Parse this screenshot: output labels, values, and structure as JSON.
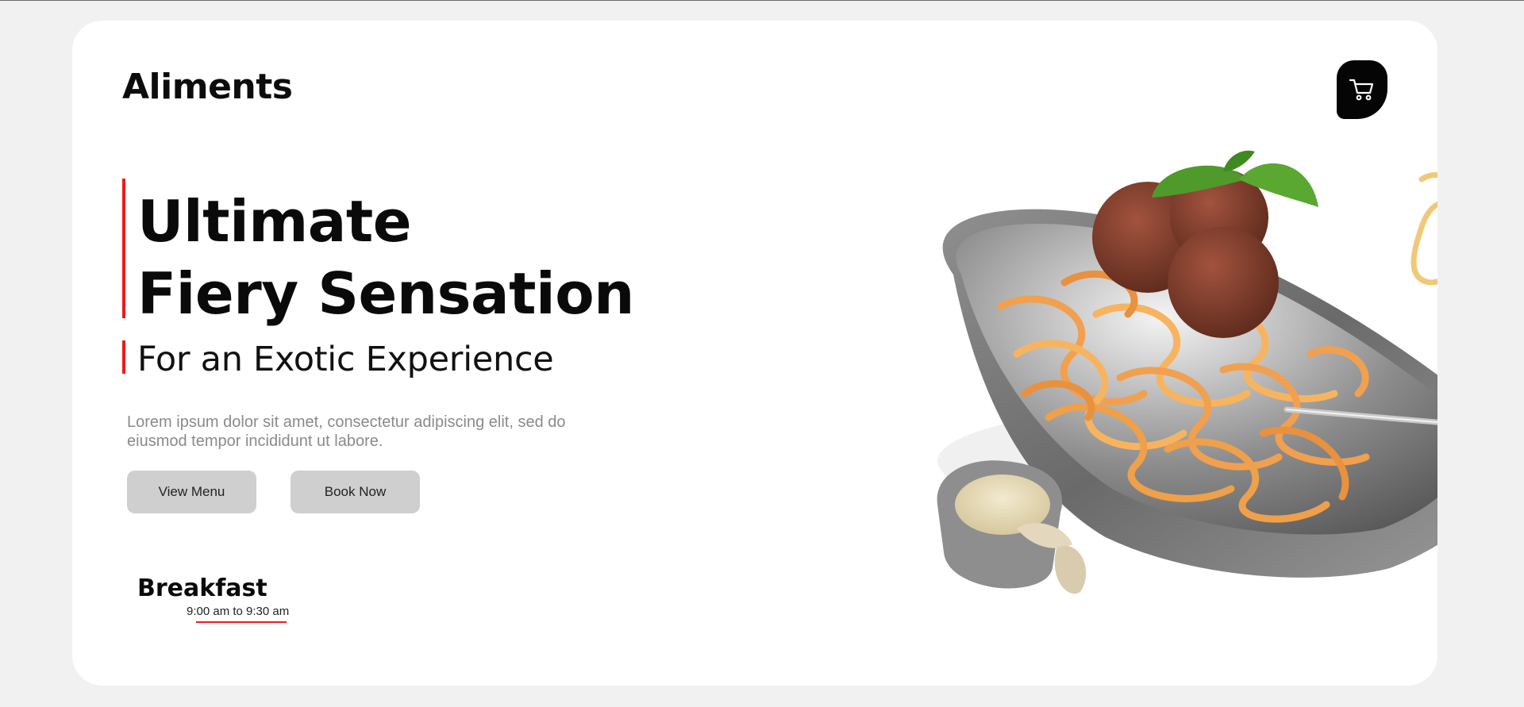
{
  "brand": {
    "name": "Aliments"
  },
  "header": {
    "cart_icon": "shopping-cart-icon"
  },
  "hero": {
    "headline_line1": "Ultimate",
    "headline_line2": "Fiery Sensation",
    "subheadline": "For an Exotic Experience",
    "description": "Lorem ipsum dolor sit amet, consectetur adipiscing elit, sed do eiusmod tempor incididunt ut labore.",
    "buttons": {
      "view_menu": "View Menu",
      "book_now": "Book Now"
    }
  },
  "meal": {
    "title": "Breakfast",
    "time": "9:00 am to 9:30 am"
  },
  "colors": {
    "accent": "#ef1b1b",
    "background": "#f1f1f1",
    "card": "#ffffff",
    "button": "#cfcfcf",
    "text": "#0a0a0a"
  }
}
